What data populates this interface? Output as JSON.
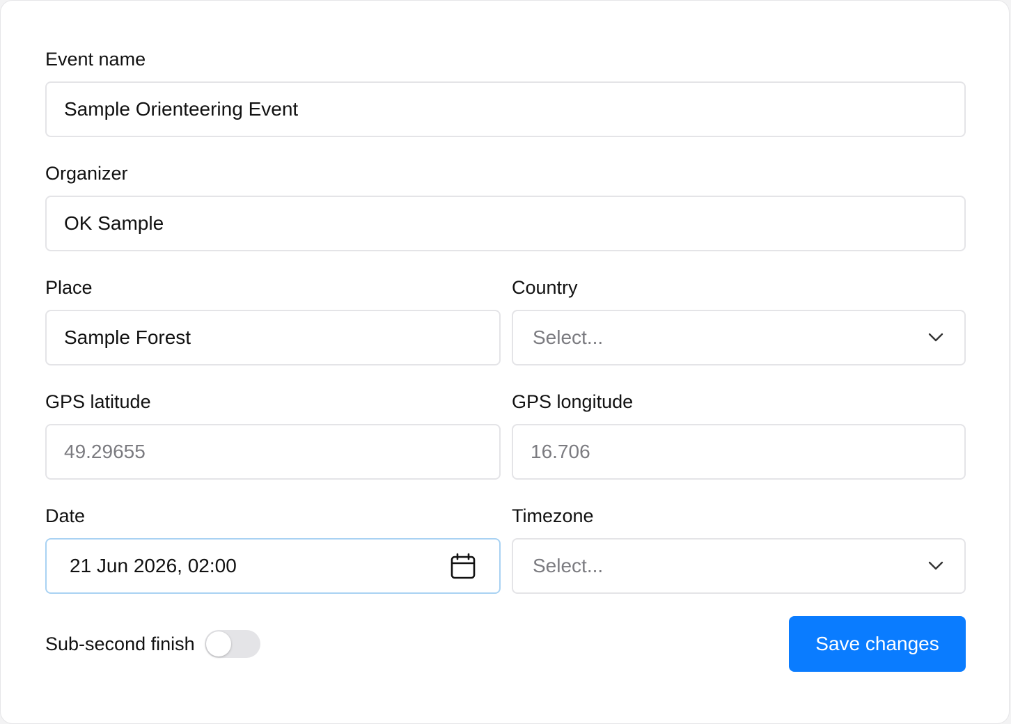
{
  "form": {
    "event_name": {
      "label": "Event name",
      "value": "Sample Orienteering Event"
    },
    "organizer": {
      "label": "Organizer",
      "value": "OK Sample"
    },
    "place": {
      "label": "Place",
      "value": "Sample Forest"
    },
    "country": {
      "label": "Country",
      "placeholder": "Select..."
    },
    "gps_latitude": {
      "label": "GPS latitude",
      "placeholder": "49.29655"
    },
    "gps_longitude": {
      "label": "GPS longitude",
      "placeholder": "16.706"
    },
    "date": {
      "label": "Date",
      "value": "21 Jun 2026, 02:00",
      "icon": "calendar-icon"
    },
    "timezone": {
      "label": "Timezone",
      "placeholder": "Select..."
    },
    "sub_second_finish": {
      "label": "Sub-second finish",
      "enabled": false
    },
    "save_label": "Save changes"
  },
  "colors": {
    "primary": "#0a7cff",
    "border": "#e4e4e7",
    "focus_border": "#a9d2f3",
    "placeholder": "#7b7b80",
    "toggle_off": "#e4e4e7"
  }
}
